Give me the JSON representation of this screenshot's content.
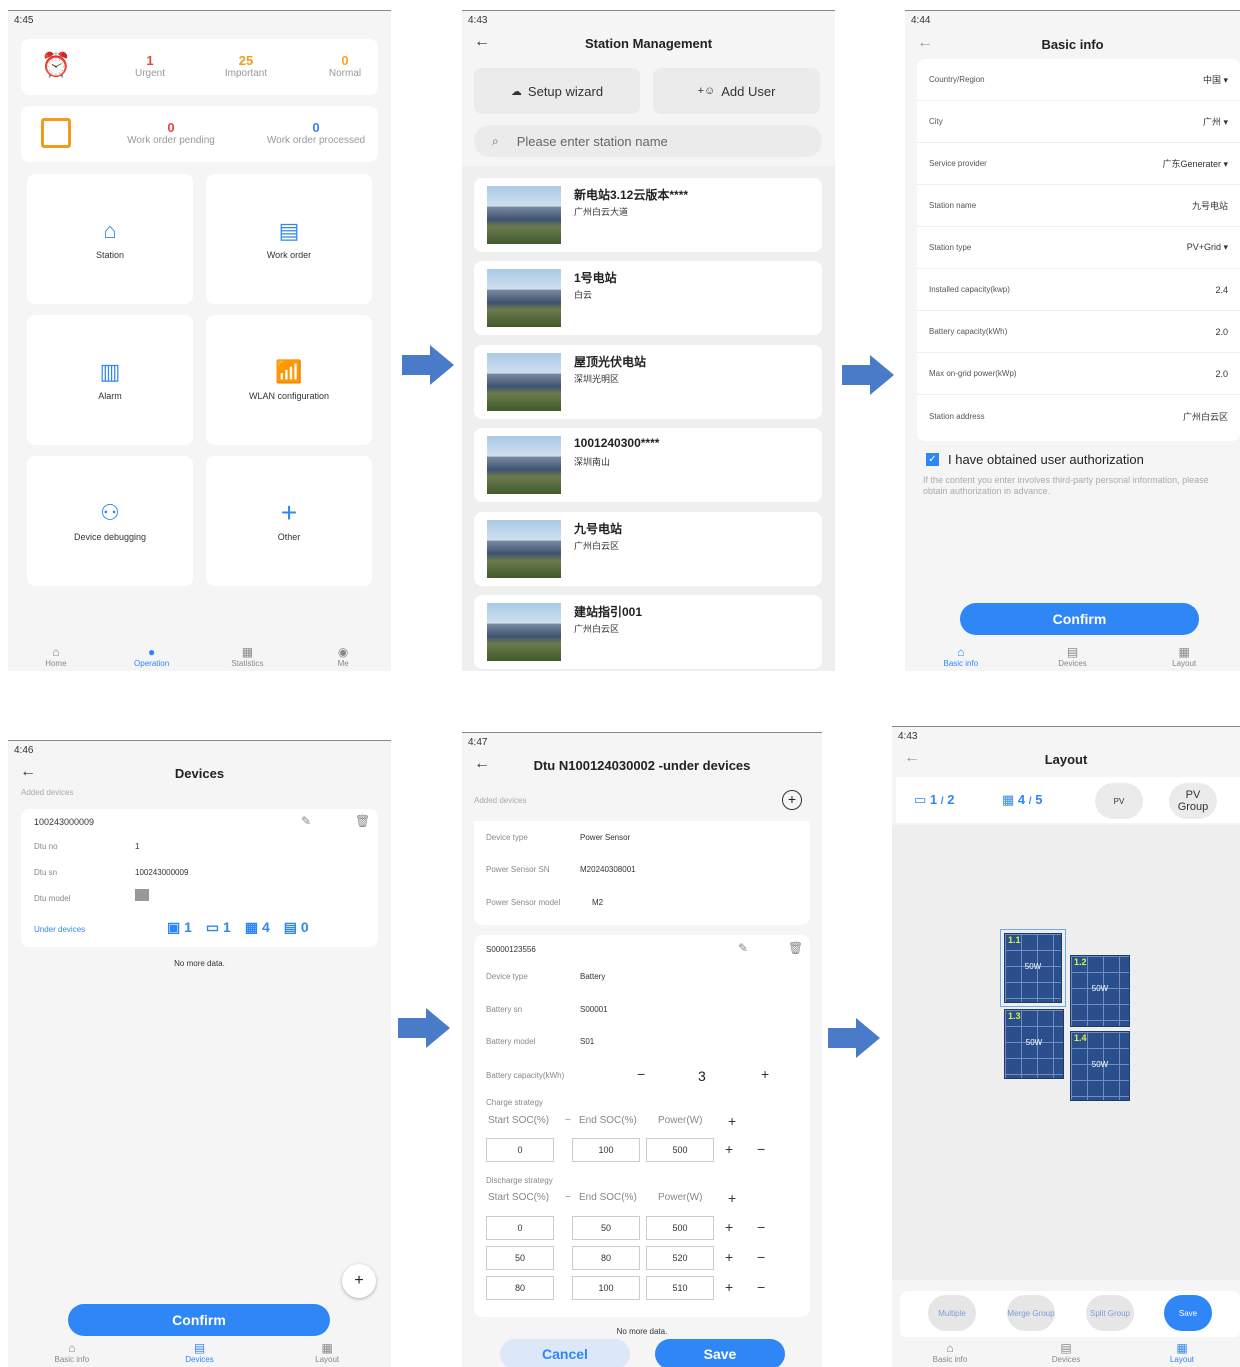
{
  "colors": {
    "accent": "#2f86f6",
    "urgent": "#e5483f",
    "important": "#f29b1d",
    "normal": "#f5a623",
    "arrow": "#4a7bc8"
  },
  "s1": {
    "time": "4:45",
    "urgent_n": "1",
    "urgent_l": "Urgent",
    "important_n": "25",
    "important_l": "Important",
    "normal_n": "0",
    "normal_l": "Normal",
    "wop_n": "0",
    "wop_l": "Work order pending",
    "wod_n": "0",
    "wod_l": "Work order processed",
    "tiles": [
      "Station",
      "Work order",
      "Alarm",
      "WLAN configuration",
      "Device debugging",
      "Other"
    ],
    "tabs": [
      "Home",
      "Operation",
      "Statistics",
      "Me"
    ]
  },
  "s2": {
    "time": "4:43",
    "title": "Station Management",
    "wizard": "Setup wizard",
    "add_user": "Add User",
    "search_ph": "Please enter station name",
    "stations": [
      {
        "name": "新电站3.12云版本****",
        "addr": "广州白云大道"
      },
      {
        "name": "1号电站",
        "addr": "白云"
      },
      {
        "name": "屋顶光伏电站",
        "addr": "深圳光明区"
      },
      {
        "name": "1001240300****",
        "addr": "深圳南山"
      },
      {
        "name": "九号电站",
        "addr": "广州白云区"
      },
      {
        "name": "建站指引001",
        "addr": "广州白云区"
      }
    ]
  },
  "s3": {
    "time": "4:44",
    "title": "Basic info",
    "rows": [
      {
        "k": "Country/Region",
        "v": "中国 ▾"
      },
      {
        "k": "City",
        "v": "广州 ▾"
      },
      {
        "k": "Service provider",
        "v": "广东Generater ▾"
      },
      {
        "k": "Station name",
        "v": "九号电站"
      },
      {
        "k": "Station type",
        "v": "PV+Grid ▾"
      },
      {
        "k": "Installed capacity(kwp)",
        "v": "2.4"
      },
      {
        "k": "Battery capacity(kWh)",
        "v": "2.0"
      },
      {
        "k": "Max on-grid power(kWp)",
        "v": "2.0"
      },
      {
        "k": "Station address",
        "v": "广州白云区"
      }
    ],
    "auth": "I have obtained user authorization",
    "note": "If the content you enter involves third-party personal information, please obtain authorization in advance.",
    "confirm": "Confirm",
    "tabs": [
      "Basic info",
      "Devices",
      "Layout"
    ]
  },
  "s4": {
    "time": "4:46",
    "title": "Devices",
    "added": "Added devices",
    "sn_title": "100243000009",
    "rows": [
      {
        "k": "Dtu no",
        "v": "1"
      },
      {
        "k": "Dtu sn",
        "v": "100243000009"
      },
      {
        "k": "Dtu model",
        "v": ""
      }
    ],
    "under": "Under devices",
    "c1": "1",
    "c2": "1",
    "c3": "4",
    "c4": "0",
    "nomore": "No more data.",
    "confirm": "Confirm",
    "tabs": [
      "Basic info",
      "Devices",
      "Layout"
    ]
  },
  "s5": {
    "time": "4:47",
    "title": "Dtu N100124030002 -under devices",
    "added": "Added devices",
    "ps": [
      {
        "k": "Device type",
        "v": "Power Sensor"
      },
      {
        "k": "Power Sensor SN",
        "v": "M20240308001"
      },
      {
        "k": "Power Sensor model",
        "v": "M2"
      }
    ],
    "bat_title": "S0000123556",
    "bat": [
      {
        "k": "Device type",
        "v": "Battery"
      },
      {
        "k": "Battery sn",
        "v": "S00001"
      },
      {
        "k": "Battery model",
        "v": "S01"
      }
    ],
    "cap_k": "Battery capacity(kWh)",
    "cap_v": "3",
    "charge": "Charge strategy",
    "discharge": "Discharge strategy",
    "h_start": "Start SOC(%)",
    "h_end": "End SOC(%)",
    "h_pow": "Power(W)",
    "charge_rows": [
      [
        "0",
        "100",
        "500"
      ]
    ],
    "dis_rows": [
      [
        "0",
        "50",
        "500"
      ],
      [
        "50",
        "80",
        "520"
      ],
      [
        "80",
        "100",
        "510"
      ]
    ],
    "nomore": "No more data.",
    "cancel": "Cancel",
    "save": "Save"
  },
  "s6": {
    "time": "4:43",
    "title": "Layout",
    "c1": "1",
    "c1t": "2",
    "c2": "4",
    "c2t": "5",
    "pv": "PV",
    "pvg": "PV Group",
    "panels": [
      {
        "id": "1.1",
        "w": "50W"
      },
      {
        "id": "1.2",
        "w": "50W"
      },
      {
        "id": "1.3",
        "w": "50W"
      },
      {
        "id": "1.4",
        "w": "50W"
      }
    ],
    "multiple": "Multiple",
    "merge": "Merge Group",
    "split": "Split Group",
    "save": "Save",
    "tabs": [
      "Basic info",
      "Devices",
      "Layout"
    ]
  }
}
